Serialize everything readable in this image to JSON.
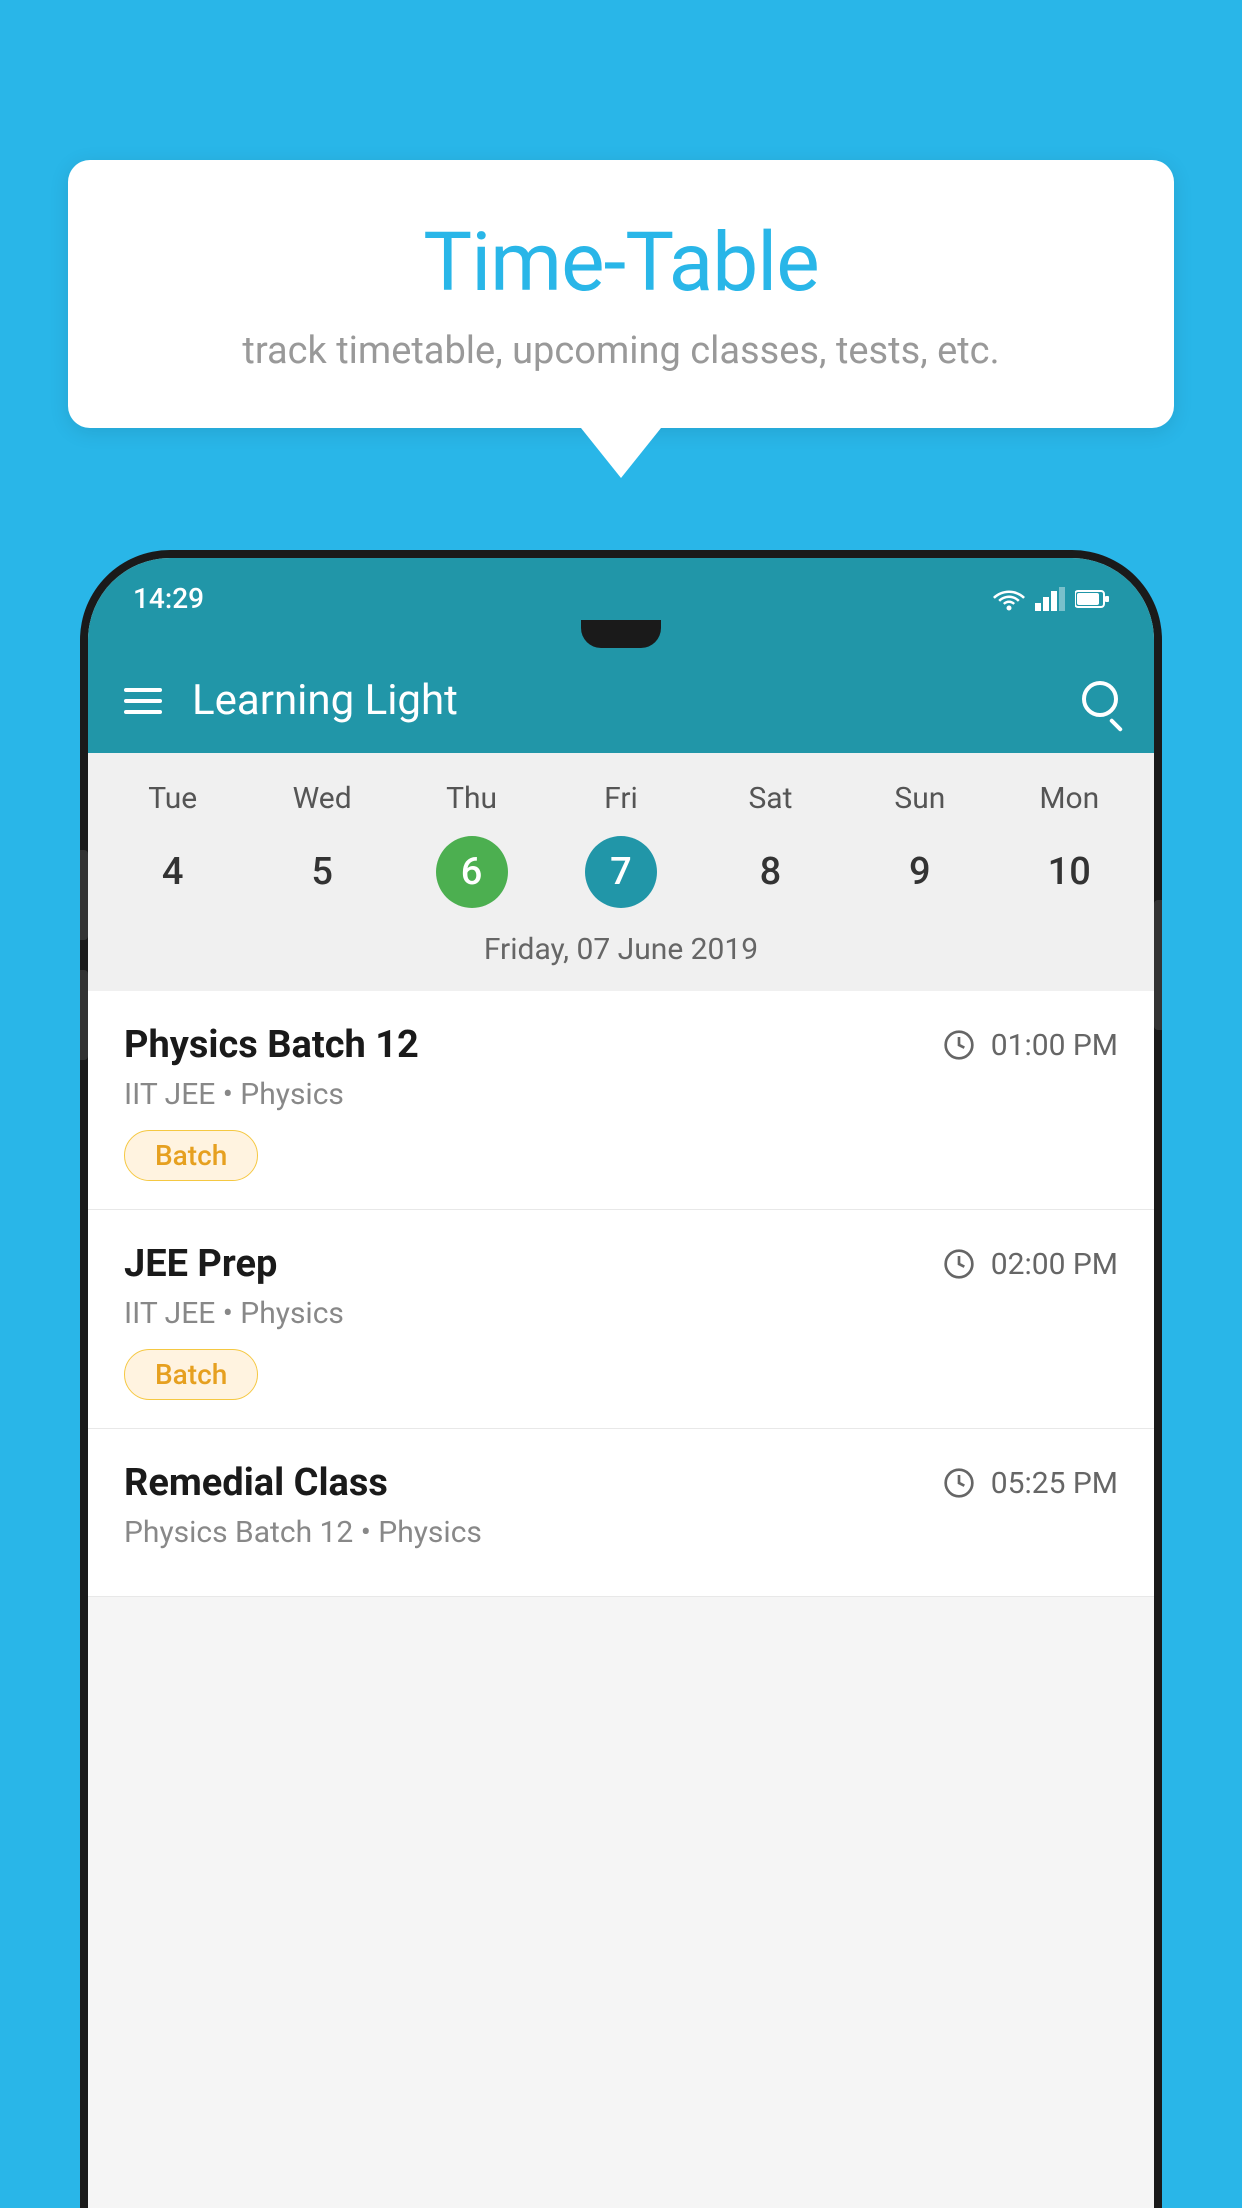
{
  "background_color": "#29b6e8",
  "speech_bubble": {
    "title": "Time-Table",
    "subtitle": "track timetable, upcoming classes, tests, etc."
  },
  "phone": {
    "status_bar": {
      "time": "14:29"
    },
    "app_bar": {
      "title": "Learning Light"
    },
    "calendar": {
      "day_names": [
        "Tue",
        "Wed",
        "Thu",
        "Fri",
        "Sat",
        "Sun",
        "Mon"
      ],
      "dates": [
        "4",
        "5",
        "6",
        "7",
        "8",
        "9",
        "10"
      ],
      "today_index": 2,
      "selected_index": 3,
      "selected_label": "Friday, 07 June 2019"
    },
    "schedule": [
      {
        "title": "Physics Batch 12",
        "time": "01:00 PM",
        "subtitle": "IIT JEE • Physics",
        "tag": "Batch"
      },
      {
        "title": "JEE Prep",
        "time": "02:00 PM",
        "subtitle": "IIT JEE • Physics",
        "tag": "Batch"
      },
      {
        "title": "Remedial Class",
        "time": "05:25 PM",
        "subtitle": "Physics Batch 12 • Physics",
        "tag": ""
      }
    ]
  }
}
